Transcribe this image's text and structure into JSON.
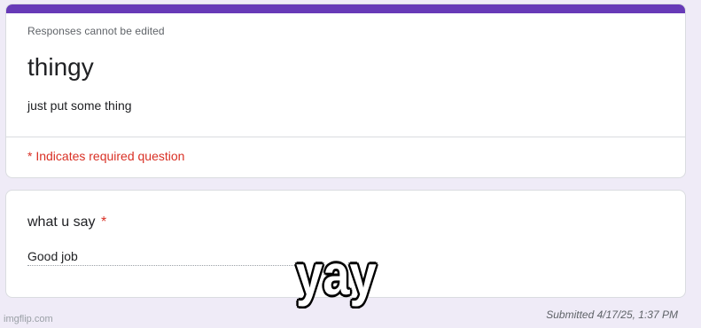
{
  "form": {
    "notice": "Responses cannot be edited",
    "title": "thingy",
    "description": "just put some thing",
    "required_note": "* Indicates required question",
    "accent_color": "#673ab7"
  },
  "question": {
    "title": "what u say",
    "required_marker": "*",
    "answer": "Good job"
  },
  "footer": {
    "submitted": "Submitted 4/17/25, 1:37 PM",
    "watermark": "imgflip.com"
  },
  "caption": {
    "text": "yay"
  }
}
